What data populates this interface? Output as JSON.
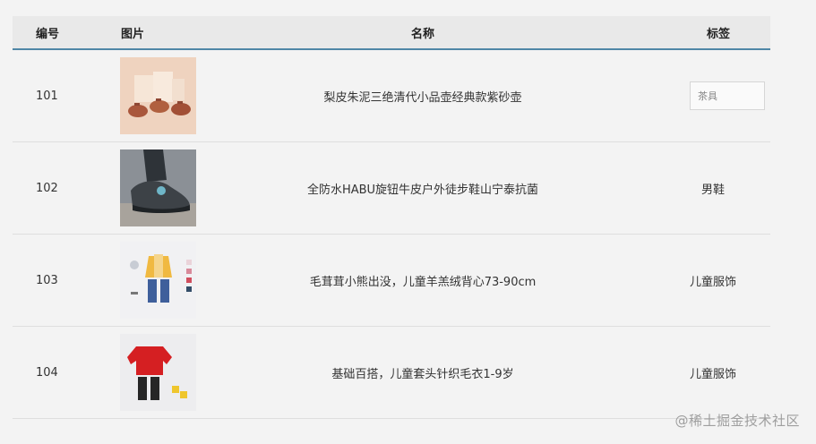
{
  "table": {
    "columns": [
      "编号",
      "图片",
      "名称",
      "标签"
    ],
    "rows": [
      {
        "id": "101",
        "image": "teapot-set-thumbnail",
        "name": "梨皮朱泥三绝清代小品壶经典款紫砂壶",
        "tag": "茶具",
        "tag_editable": true
      },
      {
        "id": "102",
        "image": "hiking-shoe-thumbnail",
        "name": "全防水HABU旋钮牛皮户外徒步鞋山宁泰抗菌",
        "tag": "男鞋",
        "tag_editable": false
      },
      {
        "id": "103",
        "image": "kids-clothing-thumbnail",
        "name": "毛茸茸小熊出没，儿童羊羔绒背心73-90cm",
        "tag": "儿童服饰",
        "tag_editable": false
      },
      {
        "id": "104",
        "image": "red-sweater-thumbnail",
        "name": "基础百搭，儿童套头针织毛衣1-9岁",
        "tag": "儿童服饰",
        "tag_editable": false
      }
    ]
  },
  "watermark": "@稀土掘金技术社区"
}
